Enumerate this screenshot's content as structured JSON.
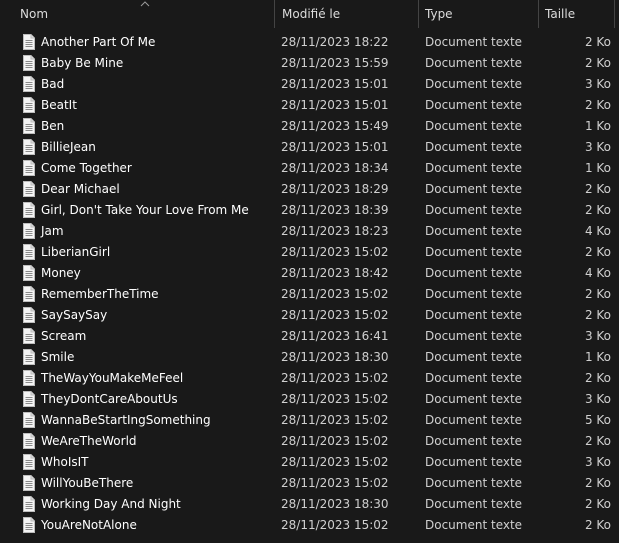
{
  "columns": {
    "name": "Nom",
    "modified": "Modifié le",
    "type": "Type",
    "size": "Taille"
  },
  "icons": {
    "sort": "chevron-up-icon",
    "file": "text-document-icon"
  },
  "files": [
    {
      "name": "Another Part Of Me",
      "modified": "28/11/2023 18:22",
      "type": "Document texte",
      "size": "2 Ko"
    },
    {
      "name": "Baby Be Mine",
      "modified": "28/11/2023 15:59",
      "type": "Document texte",
      "size": "2 Ko"
    },
    {
      "name": "Bad",
      "modified": "28/11/2023 15:01",
      "type": "Document texte",
      "size": "3 Ko"
    },
    {
      "name": "BeatIt",
      "modified": "28/11/2023 15:01",
      "type": "Document texte",
      "size": "2 Ko"
    },
    {
      "name": "Ben",
      "modified": "28/11/2023 15:49",
      "type": "Document texte",
      "size": "1 Ko"
    },
    {
      "name": "BillieJean",
      "modified": "28/11/2023 15:01",
      "type": "Document texte",
      "size": "3 Ko"
    },
    {
      "name": "Come Together",
      "modified": "28/11/2023 18:34",
      "type": "Document texte",
      "size": "1 Ko"
    },
    {
      "name": "Dear Michael",
      "modified": "28/11/2023 18:29",
      "type": "Document texte",
      "size": "2 Ko"
    },
    {
      "name": "Girl, Don't Take Your Love From Me",
      "modified": "28/11/2023 18:39",
      "type": "Document texte",
      "size": "2 Ko"
    },
    {
      "name": "Jam",
      "modified": "28/11/2023 18:23",
      "type": "Document texte",
      "size": "4 Ko"
    },
    {
      "name": "LiberianGirl",
      "modified": "28/11/2023 15:02",
      "type": "Document texte",
      "size": "2 Ko"
    },
    {
      "name": "Money",
      "modified": "28/11/2023 18:42",
      "type": "Document texte",
      "size": "4 Ko"
    },
    {
      "name": "RememberTheTime",
      "modified": "28/11/2023 15:02",
      "type": "Document texte",
      "size": "2 Ko"
    },
    {
      "name": "SaySaySay",
      "modified": "28/11/2023 15:02",
      "type": "Document texte",
      "size": "2 Ko"
    },
    {
      "name": "Scream",
      "modified": "28/11/2023 16:41",
      "type": "Document texte",
      "size": "3 Ko"
    },
    {
      "name": "Smile",
      "modified": "28/11/2023 18:30",
      "type": "Document texte",
      "size": "1 Ko"
    },
    {
      "name": "TheWayYouMakeMeFeel",
      "modified": "28/11/2023 15:02",
      "type": "Document texte",
      "size": "2 Ko"
    },
    {
      "name": "TheyDontCareAboutUs",
      "modified": "28/11/2023 15:02",
      "type": "Document texte",
      "size": "3 Ko"
    },
    {
      "name": "WannaBeStartIngSomething",
      "modified": "28/11/2023 15:02",
      "type": "Document texte",
      "size": "5 Ko"
    },
    {
      "name": "WeAreTheWorld",
      "modified": "28/11/2023 15:02",
      "type": "Document texte",
      "size": "2 Ko"
    },
    {
      "name": "WhoIsIT",
      "modified": "28/11/2023 15:02",
      "type": "Document texte",
      "size": "3 Ko"
    },
    {
      "name": "WillYouBeThere",
      "modified": "28/11/2023 15:02",
      "type": "Document texte",
      "size": "2 Ko"
    },
    {
      "name": "Working Day And Night",
      "modified": "28/11/2023 18:30",
      "type": "Document texte",
      "size": "2 Ko"
    },
    {
      "name": "YouAreNotAlone",
      "modified": "28/11/2023 15:02",
      "type": "Document texte",
      "size": "2 Ko"
    }
  ]
}
